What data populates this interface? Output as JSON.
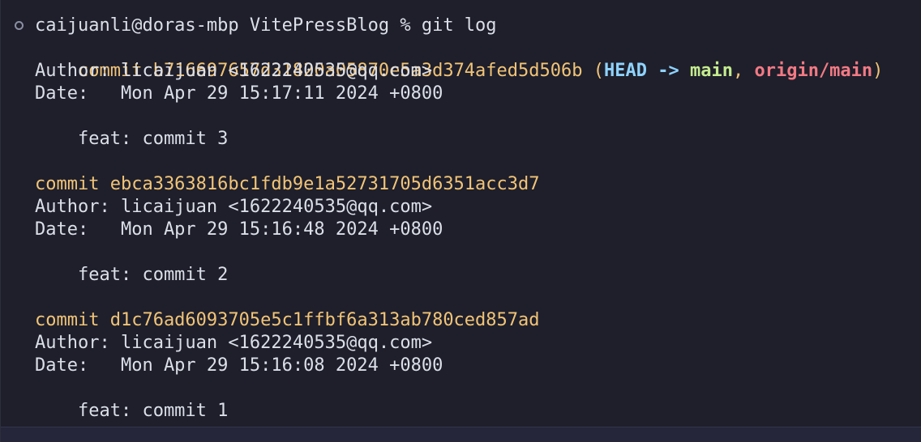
{
  "prompt": {
    "text": "caijuanli@doras-mbp VitePressBlog % git log"
  },
  "refs": {
    "open": "(",
    "head": "HEAD",
    "arrow": " -> ",
    "main": "main",
    "comma": ", ",
    "origin": "origin/main",
    "close": ")"
  },
  "commits": [
    {
      "hash_line": "commit b716697657d31820a05870e5a3d374afed5d506b",
      "author": "Author: licaijuan <1622240535@qq.com>",
      "date": "Date:   Mon Apr 29 15:17:11 2024 +0800",
      "message": "    feat: commit 3"
    },
    {
      "hash_line": "commit ebca3363816bc1fdb9e1a52731705d6351acc3d7",
      "author": "Author: licaijuan <1622240535@qq.com>",
      "date": "Date:   Mon Apr 29 15:16:48 2024 +0800",
      "message": "    feat: commit 2"
    },
    {
      "hash_line": "commit d1c76ad6093705e5c1ffbf6a313ab780ced857ad",
      "author": "Author: licaijuan <1622240535@qq.com>",
      "date": "Date:   Mon Apr 29 15:16:08 2024 +0800",
      "message": "    feat: commit 1"
    }
  ],
  "colors": {
    "background": "#1e1f2b",
    "text": "#dcdfe8",
    "commit": "#f2c477",
    "head": "#8fd3ff",
    "branch": "#c4eb8e",
    "remote": "#f27a84"
  }
}
